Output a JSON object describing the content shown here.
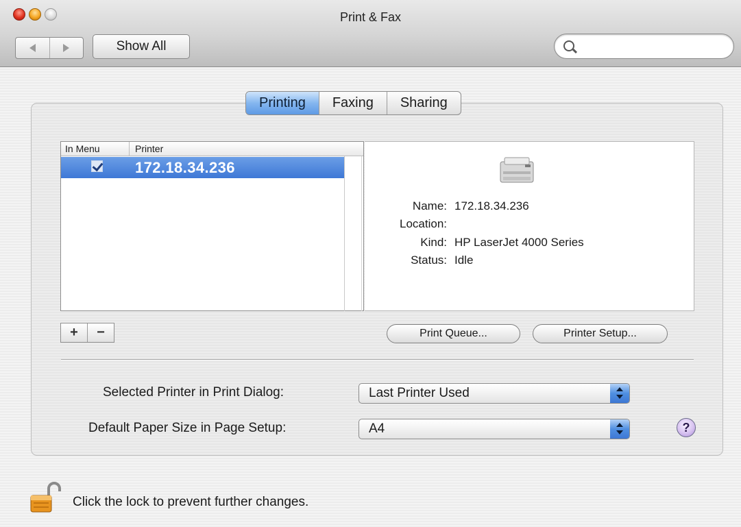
{
  "window": {
    "title": "Print & Fax"
  },
  "toolbar": {
    "show_all_label": "Show All",
    "search_placeholder": ""
  },
  "tabs": [
    {
      "label": "Printing",
      "active": true
    },
    {
      "label": "Faxing",
      "active": false
    },
    {
      "label": "Sharing",
      "active": false
    }
  ],
  "printer_list": {
    "columns": [
      "In Menu",
      "Printer"
    ],
    "rows": [
      {
        "in_menu": true,
        "name": "172.18.34.236",
        "selected": true
      }
    ]
  },
  "printer_info": {
    "name_label": "Name:",
    "name": "172.18.34.236",
    "location_label": "Location:",
    "location": "",
    "kind_label": "Kind:",
    "kind": "HP LaserJet 4000 Series",
    "status_label": "Status:",
    "status": "Idle"
  },
  "list_buttons": {
    "add": "+",
    "remove": "−"
  },
  "buttons": {
    "print_queue": "Print Queue...",
    "printer_setup": "Printer Setup..."
  },
  "settings": {
    "selected_printer_label": "Selected Printer in Print Dialog:",
    "selected_printer_value": "Last Printer Used",
    "paper_size_label": "Default Paper Size in Page Setup:",
    "paper_size_value": "A4"
  },
  "help": {
    "label": "?"
  },
  "lock": {
    "text": "Click the lock to prevent further changes."
  },
  "icons": {
    "close": "close-icon",
    "minimize": "minimize-icon",
    "zoom": "zoom-icon",
    "back": "back-arrow-icon",
    "forward": "forward-arrow-icon",
    "search": "search-icon",
    "printer": "printer-icon",
    "lock": "unlocked-padlock-icon",
    "help": "help-icon"
  },
  "colors": {
    "selection": "#3e78d6",
    "tab_active": "#84b6ef",
    "traffic_red": "#e0321f",
    "traffic_yellow": "#f5a623"
  }
}
